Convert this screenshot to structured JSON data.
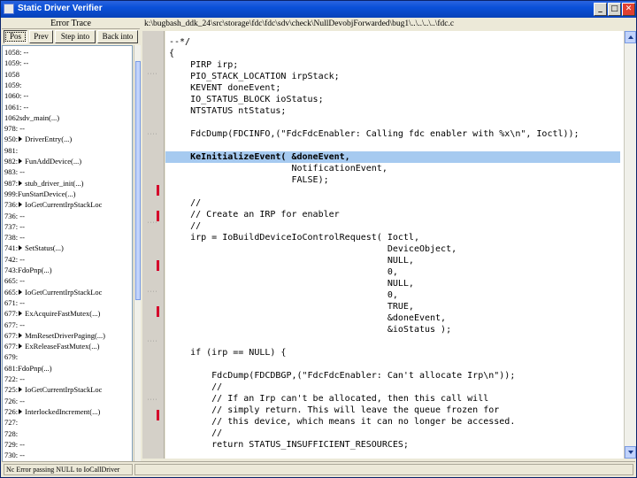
{
  "window": {
    "title": "Static Driver Verifier",
    "buttons": [
      "_",
      "□",
      "✕"
    ]
  },
  "left_pane": {
    "header": "Error Trace",
    "toolbar": [
      {
        "label": "Pos",
        "pressed": true
      },
      {
        "label": "Prev",
        "pressed": false
      },
      {
        "label": "Step into",
        "pressed": false
      },
      {
        "label": "Back into",
        "pressed": false
      }
    ],
    "trace": [
      {
        "text": "1058: --",
        "arrow": false
      },
      {
        "text": "1059: --",
        "arrow": false
      },
      {
        "text": "1058",
        "arrow": false
      },
      {
        "text": "1059:",
        "arrow": false
      },
      {
        "text": "1060: --",
        "arrow": false
      },
      {
        "text": "1061: --",
        "arrow": false
      },
      {
        "text": "1062sdv_main(...)",
        "arrow": false
      },
      {
        "text": "978: --",
        "arrow": false
      },
      {
        "text": "950:",
        "arrow": true,
        "call": "DriverEntry(...)"
      },
      {
        "text": "981:",
        "arrow": false
      },
      {
        "text": "982:",
        "arrow": true,
        "call": "FunAddDevice(...)"
      },
      {
        "text": "983: --",
        "arrow": false
      },
      {
        "text": "987:",
        "arrow": true,
        "call": "stub_driver_init(...)"
      },
      {
        "text": "999:FunStartDevice(...)",
        "arrow": false
      },
      {
        "text": "736:",
        "arrow": true,
        "call": "IoGetCurrentIrpStackLoc"
      },
      {
        "text": "736: --",
        "arrow": false
      },
      {
        "text": "737: --",
        "arrow": false
      },
      {
        "text": "738: --",
        "arrow": false
      },
      {
        "text": "741:",
        "arrow": true,
        "call": "SetStatus(...)"
      },
      {
        "text": "742: --",
        "arrow": false
      },
      {
        "text": "743:FdoPnp(...)",
        "arrow": false
      },
      {
        "text": "665: --",
        "arrow": false
      },
      {
        "text": "665:",
        "arrow": true,
        "call": "IoGetCurrentIrpStackLoc"
      },
      {
        "text": "671: --",
        "arrow": false
      },
      {
        "text": "677:",
        "arrow": true,
        "call": "ExAcquireFastMutex(...)"
      },
      {
        "text": "677: --",
        "arrow": false
      },
      {
        "text": "677:",
        "arrow": true,
        "call": "MmResetDriverPaging(...)"
      },
      {
        "text": "677:",
        "arrow": true,
        "call": "ExReleaseFastMutex(...)"
      },
      {
        "text": "679:",
        "arrow": false
      },
      {
        "text": "681:FdoPnp(...)",
        "arrow": false
      },
      {
        "text": "722: --",
        "arrow": false
      },
      {
        "text": "725:",
        "arrow": true,
        "call": "IoGetCurrentIrpStackLoc"
      },
      {
        "text": "726: --",
        "arrow": false
      },
      {
        "text": "726:",
        "arrow": true,
        "call": "InterlockedIncrement(...)"
      },
      {
        "text": "727:",
        "arrow": false
      },
      {
        "text": "728:",
        "arrow": false
      },
      {
        "text": "729: --",
        "arrow": false
      },
      {
        "text": "730: --",
        "arrow": false
      }
    ]
  },
  "code_pane": {
    "path": "k:\\bugbash_ddk_24\\src\\storage\\fdc\\fdc\\sdv\\check\\NullDevobjForwarded\\bug1\\..\\..\\..\\..\\fdc.c",
    "lines": [
      {
        "text": "--*/",
        "hl": false
      },
      {
        "text": "{",
        "hl": false
      },
      {
        "text": "    PIRP irp;",
        "hl": false
      },
      {
        "text": "    PIO_STACK_LOCATION irpStack;",
        "hl": false
      },
      {
        "text": "    KEVENT doneEvent;",
        "hl": false
      },
      {
        "text": "    IO_STATUS_BLOCK ioStatus;",
        "hl": false
      },
      {
        "text": "    NTSTATUS ntStatus;",
        "hl": false
      },
      {
        "text": "",
        "hl": false
      },
      {
        "text": "    FdcDump(FDCINFO,(\"FdcFdcEnabler: Calling fdc enabler with %x\\n\", Ioctl));",
        "hl": false
      },
      {
        "text": "",
        "hl": false
      },
      {
        "text": "    KeInitializeEvent( &doneEvent,",
        "hl": true
      },
      {
        "text": "                       NotificationEvent,",
        "hl": false
      },
      {
        "text": "                       FALSE);",
        "hl": false
      },
      {
        "text": "",
        "hl": false
      },
      {
        "text": "    //",
        "hl": false
      },
      {
        "text": "    // Create an IRP for enabler",
        "hl": false
      },
      {
        "text": "    //",
        "hl": false
      },
      {
        "text": "    irp = IoBuildDeviceIoControlRequest( Ioctl,",
        "hl": false
      },
      {
        "text": "                                         DeviceObject,",
        "hl": false
      },
      {
        "text": "                                         NULL,",
        "hl": false
      },
      {
        "text": "                                         0,",
        "hl": false
      },
      {
        "text": "                                         NULL,",
        "hl": false
      },
      {
        "text": "                                         0,",
        "hl": false
      },
      {
        "text": "                                         TRUE,",
        "hl": false
      },
      {
        "text": "                                         &doneEvent,",
        "hl": false
      },
      {
        "text": "                                         &ioStatus );",
        "hl": false
      },
      {
        "text": "",
        "hl": false
      },
      {
        "text": "    if (irp == NULL) {",
        "hl": false
      },
      {
        "text": "",
        "hl": false
      },
      {
        "text": "        FdcDump(FDCDBGP,(\"FdcFdcEnabler: Can't allocate Irp\\n\"));",
        "hl": false
      },
      {
        "text": "        //",
        "hl": false
      },
      {
        "text": "        // If an Irp can't be allocated, then this call will",
        "hl": false
      },
      {
        "text": "        // simply return. This will leave the queue frozen for",
        "hl": false
      },
      {
        "text": "        // this device, which means it can no longer be accessed.",
        "hl": false
      },
      {
        "text": "        //",
        "hl": false
      },
      {
        "text": "        return STATUS_INSUFFICIENT_RESOURCES;",
        "hl": false
      }
    ]
  },
  "status": {
    "left": "Nc Error passing NULL to IoCallDriver"
  },
  "colors": {
    "title_bar": "#0a50d8",
    "highlight": "#a6caf0",
    "red_marker": "#d4002a"
  }
}
